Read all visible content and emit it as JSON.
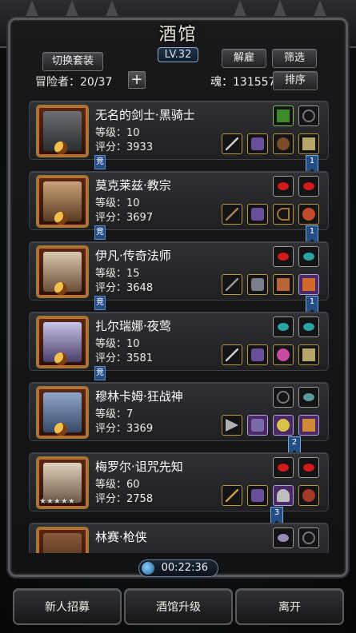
{
  "header": {
    "title": "酒馆",
    "level": "LV.32"
  },
  "toolbar": {
    "switch_outfit": "切换套装",
    "dismiss": "解雇",
    "filter": "筛选",
    "sort": "排序",
    "adventurer_count": "冒险者：20/37",
    "soul_count": "魂：131557",
    "plus": "+"
  },
  "heroes": [
    {
      "name": "无名的剑士·黑骑士",
      "level": "等级：10",
      "score": "评分：3933",
      "tag": "竞",
      "flag": "1",
      "stars": ""
    },
    {
      "name": "莫克莱兹·教宗",
      "level": "等级：10",
      "score": "评分：3697",
      "tag": "竞",
      "flag": "1",
      "stars": ""
    },
    {
      "name": "伊凡·传奇法师",
      "level": "等级：15",
      "score": "评分：3648",
      "tag": "竞",
      "flag": "1",
      "stars": ""
    },
    {
      "name": "扎尔瑞娜·夜莺",
      "level": "等级：10",
      "score": "评分：3581",
      "tag": "竞",
      "flag": "",
      "stars": ""
    },
    {
      "name": "穆林卡姆·狂战神",
      "level": "等级：7",
      "score": "评分：3369",
      "tag": "",
      "flag": "2",
      "stars": ""
    },
    {
      "name": "梅罗尔·诅咒先知",
      "level": "等级：60",
      "score": "评分：2758",
      "tag": "",
      "flag": "3",
      "stars": "★★★★★"
    },
    {
      "name": "林赛·枪侠",
      "level": "",
      "score": "",
      "tag": "",
      "flag": "",
      "stars": ""
    }
  ],
  "timer": "00:22:36",
  "bottom": {
    "recruit": "新人招募",
    "upgrade": "酒馆升级",
    "leave": "离开"
  },
  "colors": {
    "frame": "#5a5a5c",
    "accent_blue": "#234f86",
    "portrait_border": "#9b7b3e"
  }
}
